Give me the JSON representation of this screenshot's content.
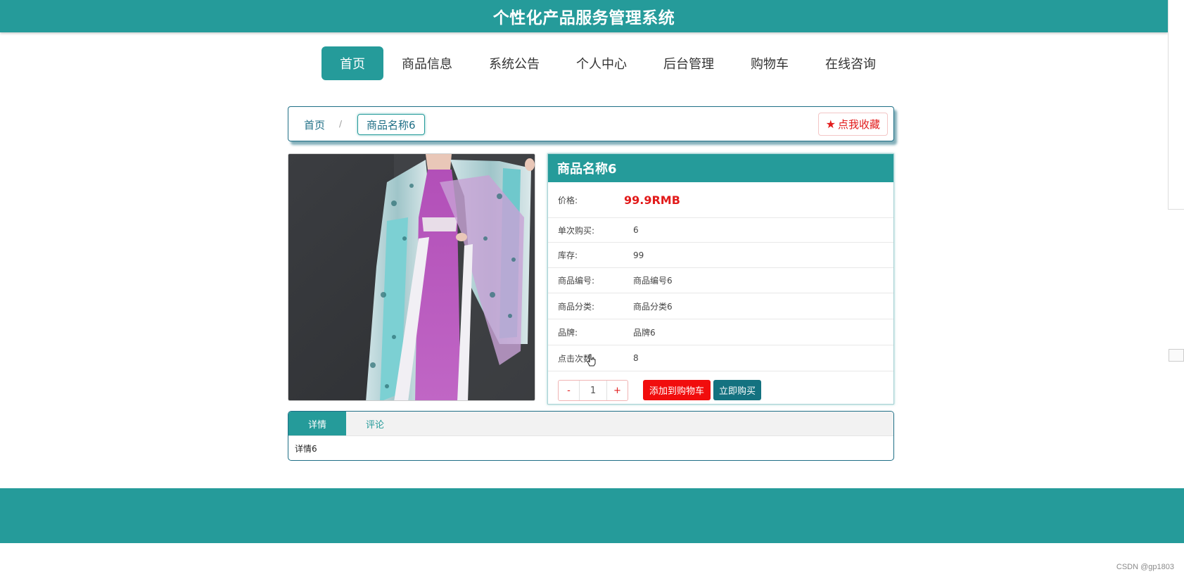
{
  "header": {
    "title": "个性化产品服务管理系统"
  },
  "nav": {
    "items": [
      {
        "label": "首页",
        "active": true
      },
      {
        "label": "商品信息",
        "active": false
      },
      {
        "label": "系统公告",
        "active": false
      },
      {
        "label": "个人中心",
        "active": false
      },
      {
        "label": "后台管理",
        "active": false
      },
      {
        "label": "购物车",
        "active": false
      },
      {
        "label": "在线咨询",
        "active": false
      }
    ]
  },
  "breadcrumb": {
    "home": "首页",
    "separator": "/",
    "current": "商品名称6"
  },
  "favorite": {
    "icon": "star-icon",
    "label": "点我收藏"
  },
  "product": {
    "name": "商品名称6",
    "price_label": "价格:",
    "price": "99.9RMB",
    "fields": [
      {
        "label": "单次购买:",
        "value": "6"
      },
      {
        "label": "库存:",
        "value": "99"
      },
      {
        "label": "商品编号:",
        "value": "商品编号6"
      },
      {
        "label": "商品分类:",
        "value": "商品分类6"
      },
      {
        "label": "品牌:",
        "value": "品牌6"
      },
      {
        "label": "点击次数:",
        "value": "8"
      }
    ],
    "quantity": {
      "minus": "-",
      "value": "1",
      "plus": "+"
    },
    "add_to_cart": "添加到购物车",
    "buy_now": "立即购买"
  },
  "tabs": {
    "items": [
      {
        "label": "详情",
        "active": true
      },
      {
        "label": "评论",
        "active": false
      }
    ],
    "content": "详情6"
  },
  "watermark": "CSDN @gp1803",
  "colors": {
    "primary": "#259b9a",
    "dark_teal": "#147280",
    "red": "#e21b1b",
    "cart_red": "#f10d0d"
  }
}
